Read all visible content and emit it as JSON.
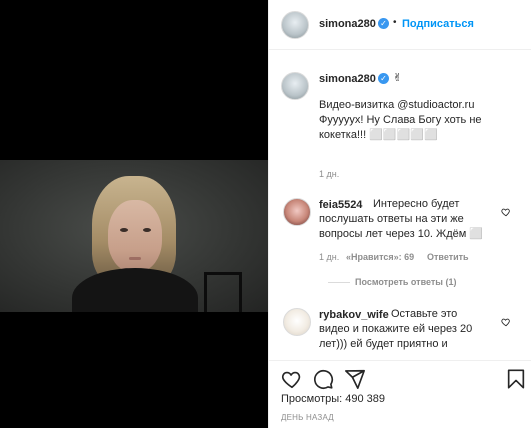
{
  "post": {
    "author": "simona280",
    "follow_label": "Подписаться",
    "dot": "•",
    "caption_emoji": "✌",
    "caption_line1": "Видео-визитка @studioactor.ru",
    "caption_line2": "Фууууух! Ну Слава Богу хоть не",
    "caption_line3": "кокетка!!! ⬜⬜⬜⬜⬜",
    "caption_time": "1 дн."
  },
  "comments": [
    {
      "user": "feia5524",
      "lines": [
        "Интересно будет",
        "послушать ответы на эти же",
        "вопросы лет через 10. Ждём ⬜"
      ],
      "time": "1 дн.",
      "likes": "«Нравится»: 69",
      "reply": "Ответить",
      "view_replies": "Посмотреть ответы (1)"
    },
    {
      "user": "rybakov_wife",
      "lines": [
        "Оставьте это",
        "видео и покажите ей через 20",
        "лет))) ей будет приятно и"
      ]
    }
  ],
  "stats": {
    "views_label": "Просмотры:",
    "views_value": "490 389",
    "ago": "ДЕНЬ НАЗАД"
  },
  "icons": {
    "like": "heart-icon",
    "comment": "comment-icon",
    "share": "share-icon",
    "save": "bookmark-icon",
    "verified": "verified-badge-icon"
  },
  "colors": {
    "accent": "#0095f6",
    "verified": "#3897f0",
    "muted": "#8e8e8e"
  }
}
